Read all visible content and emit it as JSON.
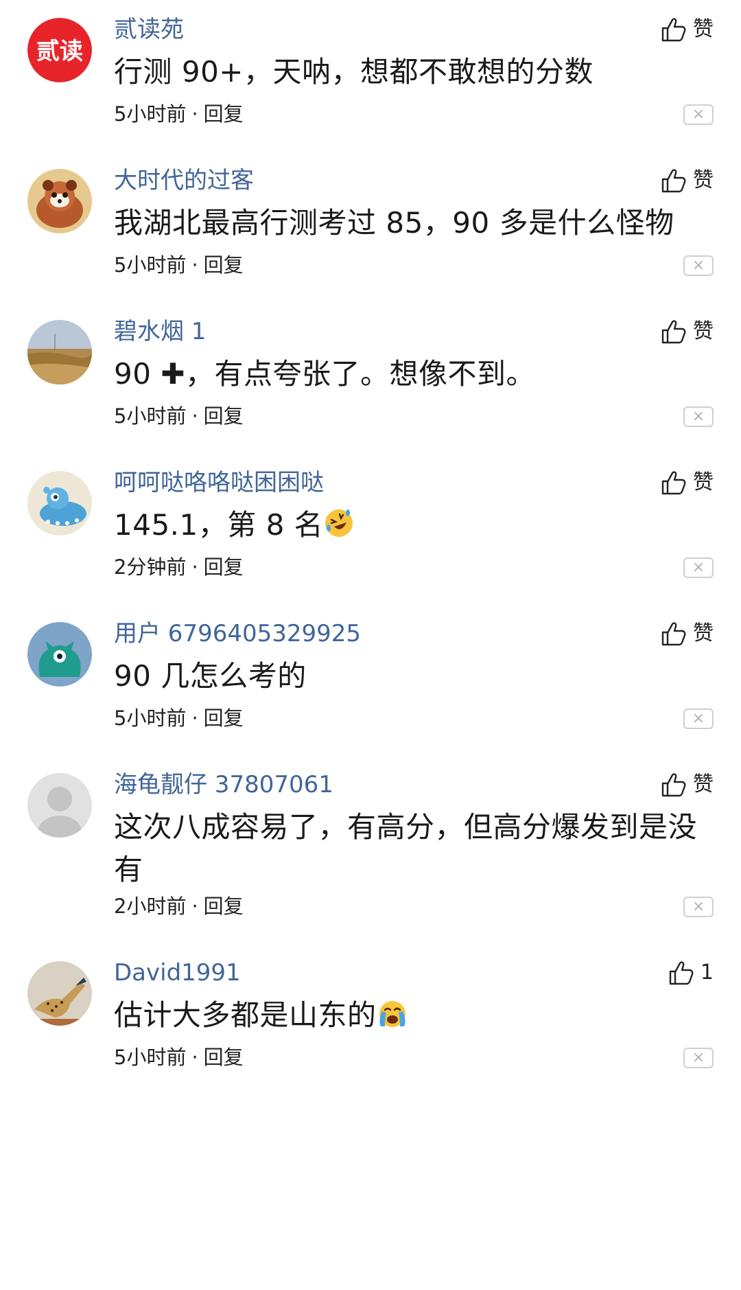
{
  "comments": [
    {
      "username": "贰读苑",
      "avatar_text": "贰读",
      "like_label": "赞",
      "content": "行测 90+，天呐，想都不敢想的分数",
      "time": "5小时前",
      "reply": "回复"
    },
    {
      "username": "大时代的过客",
      "like_label": "赞",
      "content": "我湖北最高行测考过 85，90 多是什么怪物",
      "time": "5小时前",
      "reply": "回复"
    },
    {
      "username": "碧水烟 1",
      "like_label": "赞",
      "content_before": "90 ",
      "content_symbol": "✚",
      "content_after": "，有点夸张了。想像不到。",
      "time": "5小时前",
      "reply": "回复"
    },
    {
      "username": "呵呵哒咯咯哒困困哒",
      "like_label": "赞",
      "content": "145.1，第 8 名",
      "emoji": "rolling-on-floor-laughing-emoji",
      "time": "2分钟前",
      "reply": "回复"
    },
    {
      "username": "用户 6796405329925",
      "like_label": "赞",
      "content": "90 几怎么考的",
      "time": "5小时前",
      "reply": "回复"
    },
    {
      "username": "海龟靓仔 37807061",
      "like_label": "赞",
      "content": "这次八成容易了，有高分，但高分爆发到是没有",
      "time": "2小时前",
      "reply": "回复"
    },
    {
      "username": "David1991",
      "like_label": "1",
      "content": "估计大多都是山东的",
      "emoji": "loudly-crying-face-emoji",
      "time": "5小时前",
      "reply": "回复"
    }
  ],
  "meta_separator": "·",
  "close_symbol": "×",
  "colors": {
    "username": "#406599",
    "text": "#1a1a1a",
    "avatar_red": "#e8242b"
  }
}
